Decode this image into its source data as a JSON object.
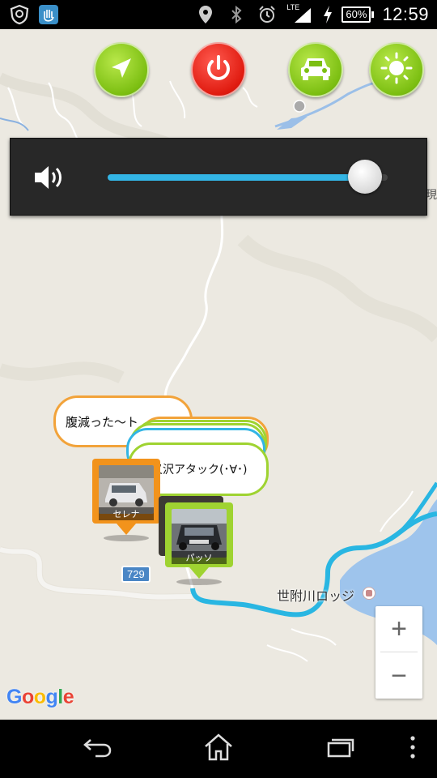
{
  "status_bar": {
    "time": "12:59",
    "battery": "60%",
    "network": "LTE",
    "icons": [
      "shield-app-icon",
      "hand-app-icon",
      "location-icon",
      "bluetooth-icon",
      "alarm-icon",
      "signal-icon",
      "charging-icon"
    ]
  },
  "toolbar": {
    "buttons": [
      {
        "name": "navigate",
        "icon": "navigation-arrow-icon",
        "color": "#7cbf12"
      },
      {
        "name": "power",
        "icon": "power-icon",
        "color": "#e01b10"
      },
      {
        "name": "car",
        "icon": "car-icon",
        "color": "#7cbf12"
      },
      {
        "name": "brightness",
        "icon": "sun-icon",
        "color": "#7cbf12"
      }
    ]
  },
  "volume": {
    "icon": "speaker-icon",
    "level": 0.92,
    "fill_color": "#33b5e5"
  },
  "map": {
    "edge_label": "瞳現",
    "road_number": "729",
    "place_label": "世附川ロッジ",
    "google_logo": {
      "letters": [
        "G",
        "o",
        "o",
        "g",
        "l",
        "e"
      ],
      "colors": [
        "#4285f4",
        "#ea4335",
        "#fbbc05",
        "#4285f4",
        "#34a853",
        "#ea4335"
      ]
    },
    "zoom_in": "+",
    "zoom_out": "−"
  },
  "markers": [
    {
      "name": "セレナ",
      "bubble": "腹減った～ト",
      "color": "#f2a33a"
    },
    {
      "name": "パッソ",
      "bubble": "大叉沢アタック(･∀･)",
      "color": "#9fd331"
    }
  ],
  "nav_bar": {
    "buttons": [
      "back-icon",
      "home-icon",
      "recent-apps-icon",
      "overflow-menu-icon"
    ]
  }
}
